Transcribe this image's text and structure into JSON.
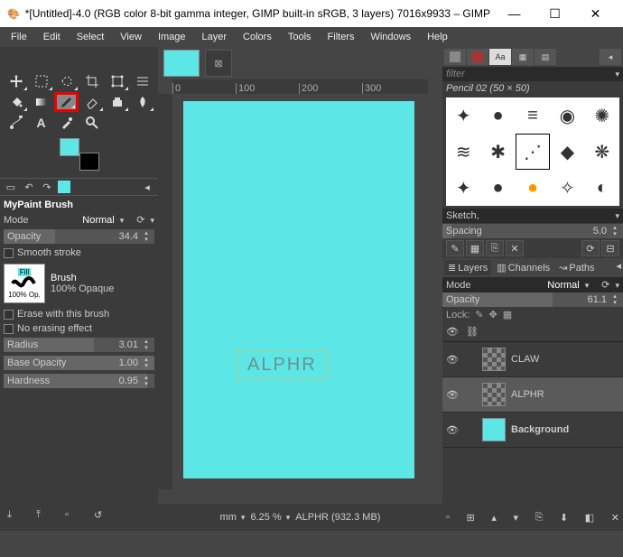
{
  "window": {
    "title_prefix": "*[Untitled]-4.0 (RGB color 8-bit gamma integer, GIMP built-in sRGB, 3 layers) 7016x9933 – GIMP",
    "minimize": "—",
    "maximize": "☐",
    "close": "✕"
  },
  "menu": [
    "File",
    "Edit",
    "Select",
    "View",
    "Image",
    "Layer",
    "Colors",
    "Tools",
    "Filters",
    "Windows",
    "Help"
  ],
  "toolopts": {
    "title": "MyPaint Brush",
    "mode_label": "Mode",
    "mode_value": "Normal",
    "opacity_label": "Opacity",
    "opacity_value": "34.4",
    "smooth": "Smooth stroke",
    "brush_label": "Brush",
    "brush_fill": "Fill",
    "brush_op": "100% Op.",
    "brush_desc": "100% Opaque",
    "erase": "Erase with this brush",
    "noerase": "No erasing effect",
    "radius_label": "Radius",
    "radius_value": "3.01",
    "baseop_label": "Base Opacity",
    "baseop_value": "1.00",
    "hardness_label": "Hardness",
    "hardness_value": "0.95"
  },
  "brushpanel": {
    "filter_placeholder": "filter",
    "brush_name": "Pencil 02 (50 × 50)",
    "shape_label": "Sketch,",
    "spacing_label": "Spacing",
    "spacing_value": "5.0"
  },
  "layerspanel": {
    "tabs": [
      "Layers",
      "Channels",
      "Paths"
    ],
    "mode_label": "Mode",
    "mode_value": "Normal",
    "opacity_label": "Opacity",
    "opacity_value": "61.1",
    "lock_label": "Lock:",
    "layers": [
      {
        "name": "CLAW",
        "visible": true,
        "thumb": "checker"
      },
      {
        "name": "ALPHR",
        "visible": true,
        "thumb": "checker",
        "active": true
      },
      {
        "name": "Background",
        "visible": true,
        "thumb": "cyan",
        "bold": true
      }
    ]
  },
  "canvas": {
    "text": "ALPHR",
    "ruler_marks": [
      "0",
      "100",
      "200",
      "300"
    ]
  },
  "status": {
    "unit": "mm",
    "zoom": "6.25 %",
    "info": "ALPHR (932.3 MB)"
  },
  "colors": {
    "accent": "#5ce6e6",
    "highlight": "#e00"
  }
}
